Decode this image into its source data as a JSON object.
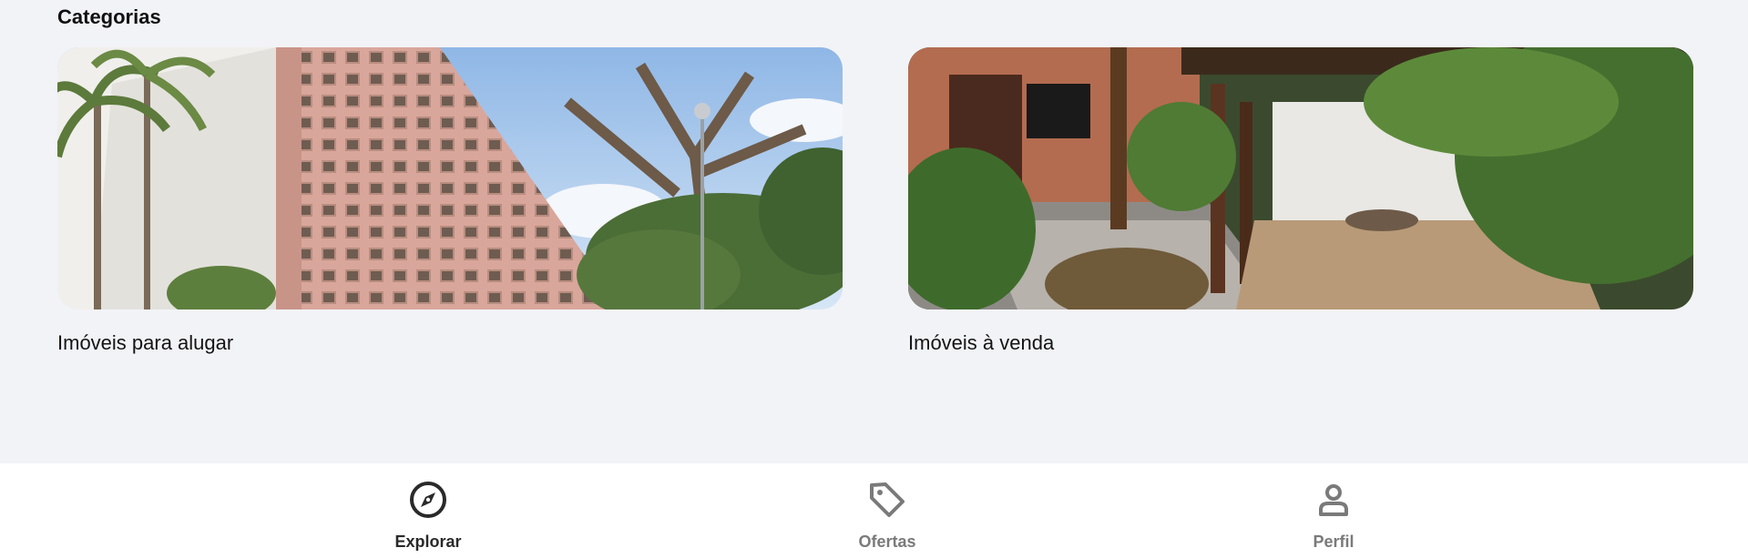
{
  "categories": {
    "title": "Categorias",
    "items": [
      {
        "label": "Imóveis para alugar",
        "image": "apartment-building-photo"
      },
      {
        "label": "Imóveis à venda",
        "image": "house-garden-porch-photo"
      }
    ]
  },
  "bottom_nav": {
    "items": [
      {
        "label": "Explorar",
        "icon": "compass-icon",
        "active": true
      },
      {
        "label": "Ofertas",
        "icon": "tag-icon",
        "active": false
      },
      {
        "label": "Perfil",
        "icon": "user-icon",
        "active": false
      }
    ]
  },
  "colors": {
    "background": "#f2f3f7",
    "nav_background": "#ffffff",
    "active": "#2a2a2a",
    "inactive": "#7a7a7a"
  }
}
